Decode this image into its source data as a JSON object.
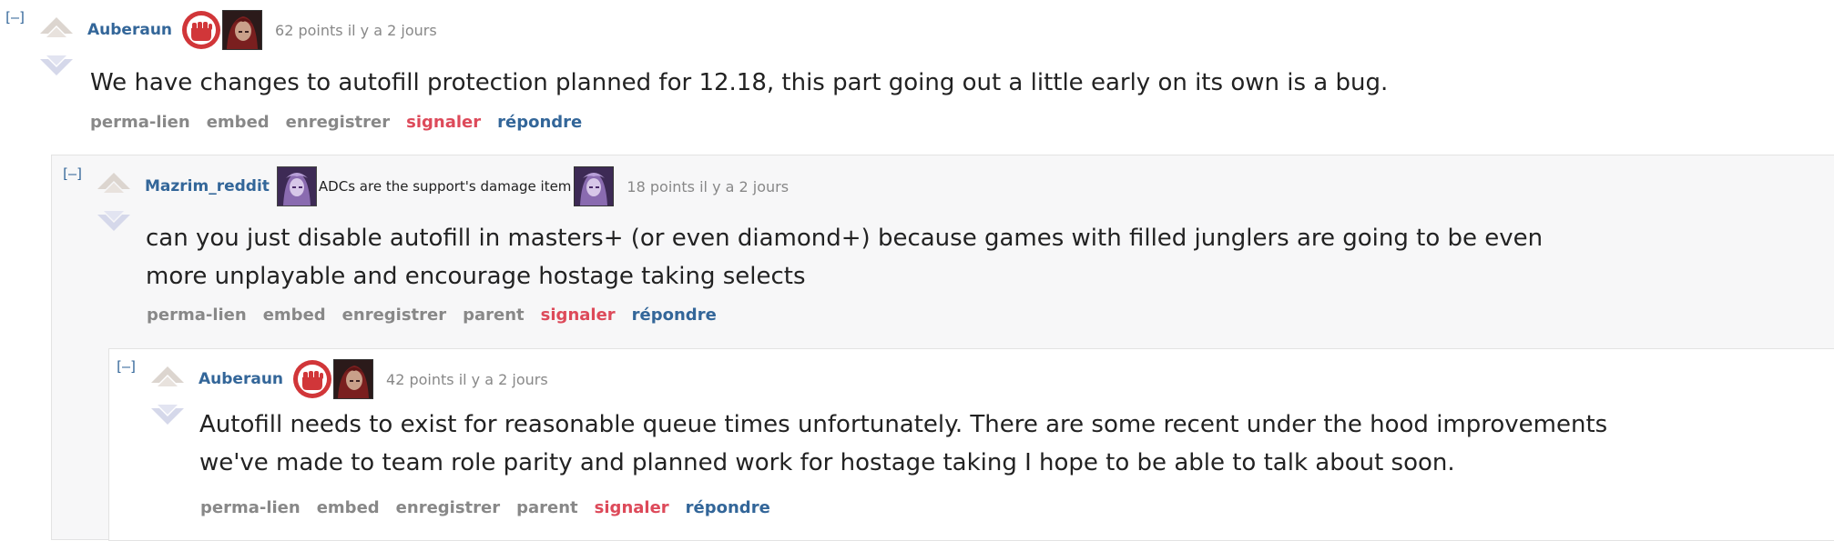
{
  "colors": {
    "author": "#336699",
    "meta": "#888888",
    "report": "#dd4a5a",
    "reply": "#336699",
    "nested_bg": "#f7f7f8"
  },
  "comments": [
    {
      "collapse": "[–]",
      "author": "Auberaun",
      "flair_badge": "riot-fist-icon",
      "flair_champion": "champion-portrait-icon",
      "meta": "62 points il y a 2 jours",
      "body_lines": [
        "We have changes to autofill protection planned for 12.18, this part going out a little early on its own is a bug."
      ],
      "buttons": [
        "perma-lien",
        "embed",
        "enregistrer",
        "signaler",
        "répondre"
      ]
    },
    {
      "collapse": "[–]",
      "author": "Mazrim_reddit",
      "flair_text": "ADCs are the support's damage item",
      "flair_champion": "champion-portrait-icon",
      "meta": "18 points il y a 2 jours",
      "body_lines": [
        "can you just disable autofill in masters+ (or even diamond+) because games with filled junglers are going to be even",
        "more unplayable and encourage hostage taking selects"
      ],
      "buttons": [
        "perma-lien",
        "embed",
        "enregistrer",
        "parent",
        "signaler",
        "répondre"
      ]
    },
    {
      "collapse": "[–]",
      "author": "Auberaun",
      "flair_badge": "riot-fist-icon",
      "flair_champion": "champion-portrait-icon",
      "meta": "42 points il y a 2 jours",
      "body_lines": [
        "Autofill needs to exist for reasonable queue times unfortunately. There are some recent under the hood improvements",
        "we've made to team role parity and planned work for hostage taking I hope to be able to talk about soon."
      ],
      "buttons": [
        "perma-lien",
        "embed",
        "enregistrer",
        "parent",
        "signaler",
        "répondre"
      ]
    }
  ]
}
